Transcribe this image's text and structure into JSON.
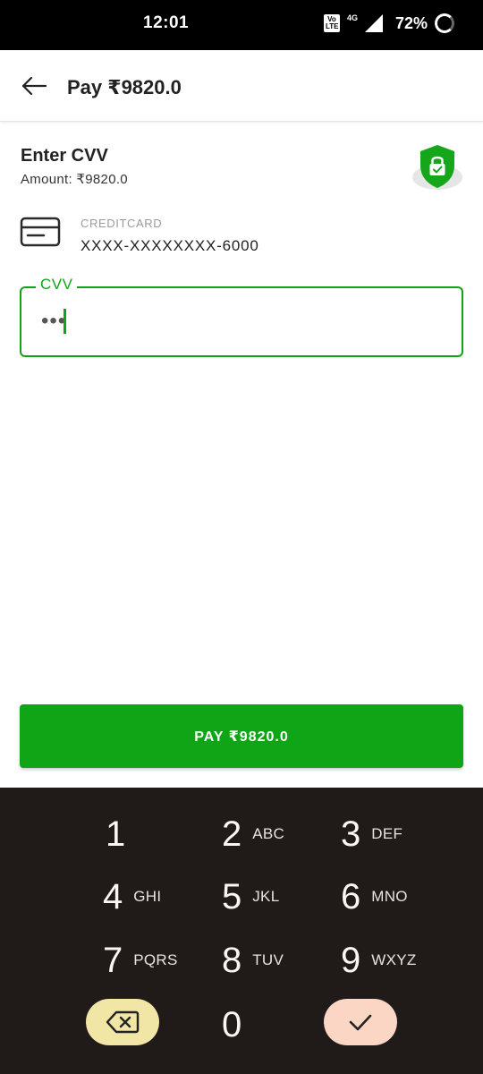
{
  "status_bar": {
    "time": "12:01",
    "volte": "Vo LTE",
    "network": "4G",
    "battery": "72%"
  },
  "header": {
    "back_icon": "arrow-left-icon",
    "title": "Pay ₹9820.0"
  },
  "payment": {
    "heading": "Enter CVV",
    "amount": "Amount: ₹9820.0",
    "security_icon": "shield-lock-icon",
    "card_icon": "credit-card-icon",
    "card_type": "CREDITCARD",
    "card_number": "XXXX-XXXXXXXX-6000"
  },
  "cvv_field": {
    "label": "CVV",
    "value": "•••"
  },
  "pay_button": {
    "label": "PAY ₹9820.0"
  },
  "keypad": {
    "keys": [
      {
        "digit": "1",
        "letters": ""
      },
      {
        "digit": "2",
        "letters": "ABC"
      },
      {
        "digit": "3",
        "letters": "DEF"
      },
      {
        "digit": "4",
        "letters": "GHI"
      },
      {
        "digit": "5",
        "letters": "JKL"
      },
      {
        "digit": "6",
        "letters": "MNO"
      },
      {
        "digit": "7",
        "letters": "PQRS"
      },
      {
        "digit": "8",
        "letters": "TUV"
      },
      {
        "digit": "9",
        "letters": "WXYZ"
      },
      {
        "digit": "0",
        "letters": ""
      }
    ],
    "backspace_icon": "backspace-icon",
    "done_icon": "checkmark-icon"
  },
  "colors": {
    "accent_green": "#0fa516",
    "keypad_bg": "#201b19",
    "backspace_pill": "#f1e6a6",
    "done_pill": "#fcd6c5"
  }
}
